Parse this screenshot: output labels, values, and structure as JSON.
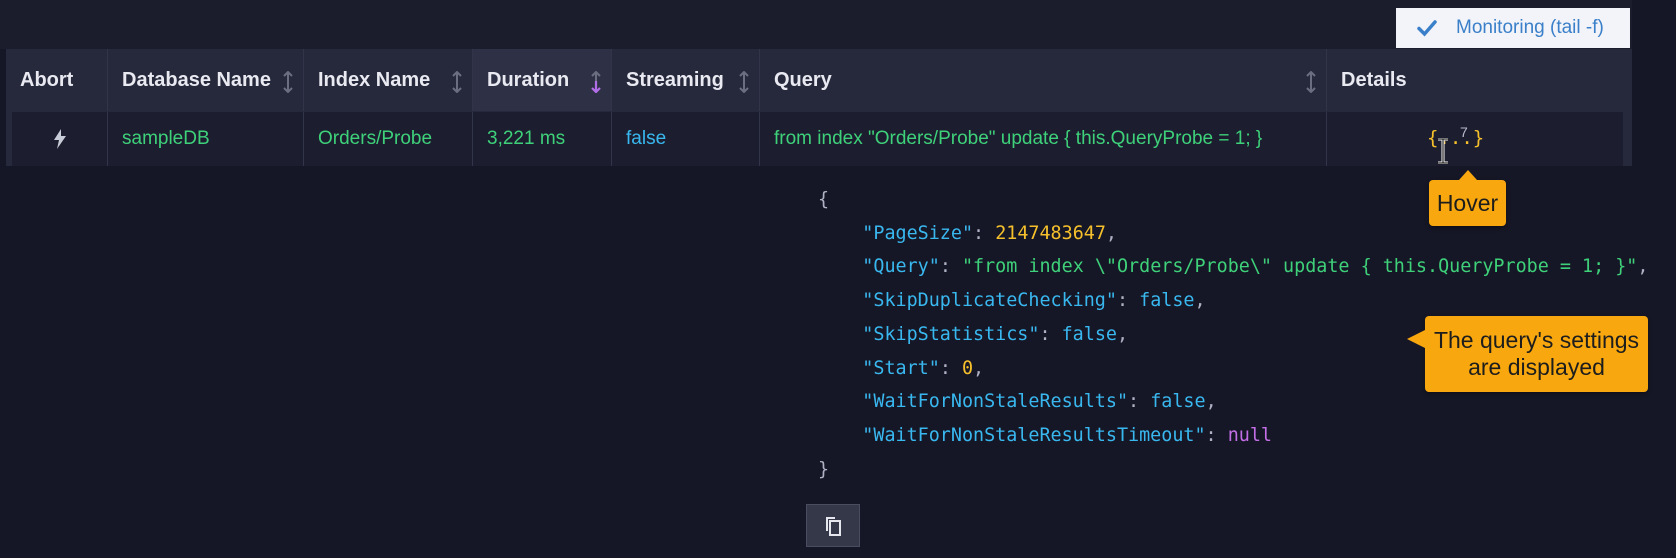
{
  "toolbar": {
    "monitoring_label": "Monitoring (tail -f)"
  },
  "table": {
    "columns": [
      "Abort",
      "Database Name",
      "Index Name",
      "Duration",
      "Streaming",
      "Query",
      "Details"
    ],
    "row": {
      "database": "sampleDB",
      "index": "Orders/Probe",
      "duration": "3,221 ms",
      "streaming": "false",
      "query": "from index \"Orders/Probe\" update { this.QueryProbe = 1; }",
      "details_icon": "{...}",
      "details_count": "7"
    }
  },
  "details": {
    "open_brace": "{",
    "close_brace": "}",
    "fields": [
      {
        "key": "\"PageSize\"",
        "value": "2147483647",
        "type": "number",
        "comma": ","
      },
      {
        "key": "\"Query\"",
        "value": "\"from index \\\"Orders/Probe\\\" update { this.QueryProbe = 1; }\"",
        "type": "string",
        "comma": ","
      },
      {
        "key": "\"SkipDuplicateChecking\"",
        "value": "false",
        "type": "bool",
        "comma": ","
      },
      {
        "key": "\"SkipStatistics\"",
        "value": "false",
        "type": "bool",
        "comma": ","
      },
      {
        "key": "\"Start\"",
        "value": "0",
        "type": "number",
        "comma": ","
      },
      {
        "key": "\"WaitForNonStaleResults\"",
        "value": "false",
        "type": "bool",
        "comma": ","
      },
      {
        "key": "\"WaitForNonStaleResultsTimeout\"",
        "value": "null",
        "type": "null",
        "comma": ""
      }
    ]
  },
  "annotations": {
    "hover": "Hover",
    "settings_line1": "The query's settings",
    "settings_line2": "are displayed"
  },
  "colors": {
    "accent_green": "#3ed17a",
    "accent_blue": "#39b8f0",
    "accent_yellow": "#f5c02c",
    "callout": "#f8a80e",
    "sort_active": "#b26ee8"
  },
  "icons": {
    "monitoring": "check-icon",
    "abort": "lightning-icon",
    "sort": "sort-arrows-icon",
    "copy": "copy-icon",
    "cursor": "text-cursor-icon"
  }
}
